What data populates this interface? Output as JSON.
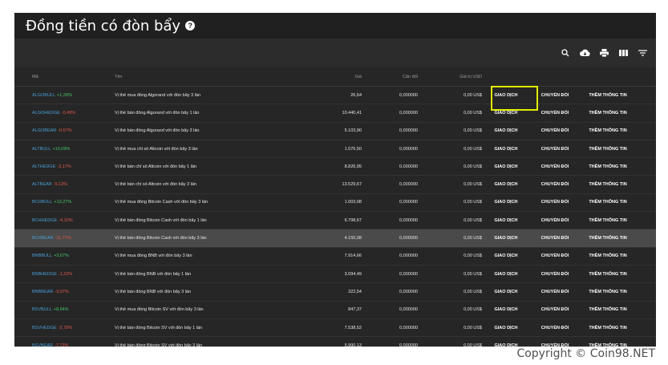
{
  "page": {
    "title": "Đồng tiền có đòn bẩy",
    "help_icon": "?"
  },
  "toolbar": {
    "icons": [
      "search-icon",
      "cloud-download-icon",
      "print-icon",
      "columns-icon",
      "filter-icon"
    ]
  },
  "table": {
    "headers": {
      "code": "Mã",
      "name": "Tên",
      "price": "Giá",
      "balance": "Cân đối",
      "usd": "Giá trị USD"
    },
    "action_labels": {
      "trade": "GIAO DỊCH",
      "convert": "CHUYỂN ĐỔI",
      "info": "THÊM THÔNG TIN"
    },
    "rows": [
      {
        "symbol": "ALGOBULL",
        "change": "+1,28%",
        "name": "Vị thế mua đồng Algorand với đòn bẩy 3 lần",
        "price": "26,64",
        "balance": "0,000000",
        "usd": "0,00 US$"
      },
      {
        "symbol": "ALGOHEDGE",
        "change": "-0,49%",
        "name": "Vị thế bán đồng Algorand với đòn bẩy 1 lần",
        "price": "10.440,41",
        "balance": "0,000000",
        "usd": "0,00 US$"
      },
      {
        "symbol": "ALGOBEAR",
        "change": "-0,67%",
        "name": "Vị thế bán đồng Algorand với đòn bẩy 3 lần",
        "price": "5.103,90",
        "balance": "0,000000",
        "usd": "0,00 US$"
      },
      {
        "symbol": "ALTBULL",
        "change": "+10,09%",
        "name": "Vị thế mua chỉ số Altcoin với đòn bẩy 3 lần",
        "price": "1.076,50",
        "balance": "0,000000",
        "usd": "0,00 US$"
      },
      {
        "symbol": "ALTHEDGE",
        "change": "-3,17%",
        "name": "Vị thế bán chỉ số Altcoin với đòn bẩy 1 lần",
        "price": "8.826,95",
        "balance": "0,000000",
        "usd": "0,00 US$"
      },
      {
        "symbol": "ALTBEAR",
        "change": "-9,13%",
        "name": "Vị thế bán chỉ số Altcoin với đòn bẩy 3 lần",
        "price": "13.529,67",
        "balance": "0,000000",
        "usd": "0,00 US$"
      },
      {
        "symbol": "BCHBULL",
        "change": "+13,27%",
        "name": "Vị thế mua đồng Bitcoin Cash với đòn bẩy 3 lần",
        "price": "1.003,08",
        "balance": "0,000000",
        "usd": "0,00 US$"
      },
      {
        "symbol": "BCHHEDGE",
        "change": "-4,10%",
        "name": "Vị thế bán đồng Bitcoin Cash với đòn bẩy 1 lần",
        "price": "6.798,67",
        "balance": "0,000000",
        "usd": "0,00 US$"
      },
      {
        "symbol": "BCHBEAR",
        "change": "-11,77%",
        "name": "Vị thế bán đồng Bitcoin Cash với đòn bẩy 3 lần",
        "price": "4.155,08",
        "balance": "0,000000",
        "usd": "0,00 US$",
        "highlight": true
      },
      {
        "symbol": "BNBBULL",
        "change": "+3,67%",
        "name": "Vị thế mua đồng BNB với đòn bẩy 3 lần",
        "price": "7.914,66",
        "balance": "0,000000",
        "usd": "0,00 US$"
      },
      {
        "symbol": "BNBHEDGE",
        "change": "-1,22%",
        "name": "Vị thế bán đồng BNB với đòn bẩy 1 lần",
        "price": "3.094,49",
        "balance": "0,000000",
        "usd": "0,00 US$"
      },
      {
        "symbol": "BNBBEAR",
        "change": "-3,97%",
        "name": "Vị thế bán đồng BNB với đòn bẩy 3 lần",
        "price": "322,54",
        "balance": "0,000000",
        "usd": "0,00 US$"
      },
      {
        "symbol": "BSVBULL",
        "change": "+8,64%",
        "name": "Vị thế mua đồng Bitcoin SV với đòn bẩy 3 lần",
        "price": "847,37",
        "balance": "0,000000",
        "usd": "0,00 US$"
      },
      {
        "symbol": "BSVHEDGE",
        "change": "-2,70%",
        "name": "Vị thế bán đồng Bitcoin SV với đòn bẩy 1 lần",
        "price": "7.538,52",
        "balance": "0,000000",
        "usd": "0,00 US$"
      },
      {
        "symbol": "BSVBEAR",
        "change": "-7,73%",
        "name": "Vị thế bán đồng Bitcoin SV với đòn bẩy 3 lần",
        "price": "5.990,13",
        "balance": "0,000000",
        "usd": "0,00 US$"
      }
    ]
  },
  "footer": {
    "copyright": "Copyright © Coin98.NET"
  },
  "colors": {
    "highlight_box": "#e2f000",
    "positive": "#46c46c",
    "negative": "#e0584e",
    "symbol": "#4a9fd8"
  }
}
